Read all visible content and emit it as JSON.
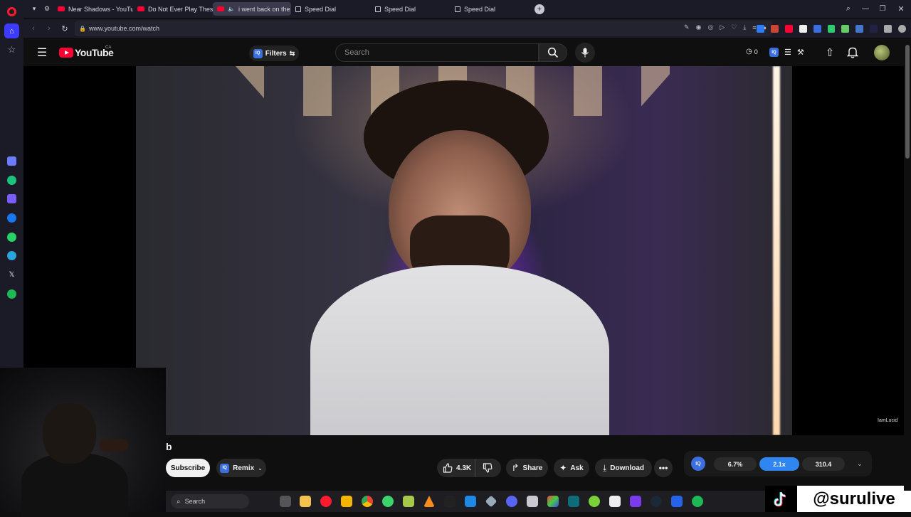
{
  "browser": {
    "tabs": [
      {
        "label": "Near Shadows - YouTube",
        "active": false
      },
      {
        "label": "Do Not Ever Play These G",
        "active": false
      },
      {
        "label": "i went back on the da",
        "active": true
      },
      {
        "label": "Speed Dial",
        "active": false
      },
      {
        "label": "Speed Dial",
        "active": false
      },
      {
        "label": "Speed Dial",
        "active": false
      }
    ],
    "url": "www.youtube.com/watch"
  },
  "youtube": {
    "logo_text": "YouTube",
    "region": "CA",
    "filters_label": "Filters",
    "iq_badge": "IQ",
    "search_placeholder": "Search",
    "header_counter": "0"
  },
  "video": {
    "watermark": "IamLucid"
  },
  "below_video": {
    "channel_partial": "b",
    "subscribe_label": "Subscribe",
    "remix_label": "Remix",
    "like_count": "4.3K",
    "share_label": "Share",
    "ask_label": "Ask",
    "download_label": "Download"
  },
  "iq_widget": {
    "badge": "IQ",
    "stat1": "6.7%",
    "stat2": "2.1x",
    "stat3": "310.4"
  },
  "taskbar": {
    "search_label": "Search"
  },
  "overlay": {
    "handle": "@surulive"
  },
  "colors": {
    "youtube_red": "#ff0033",
    "iq_blue": "#3b6fe0",
    "background": "#0f0f0f"
  }
}
